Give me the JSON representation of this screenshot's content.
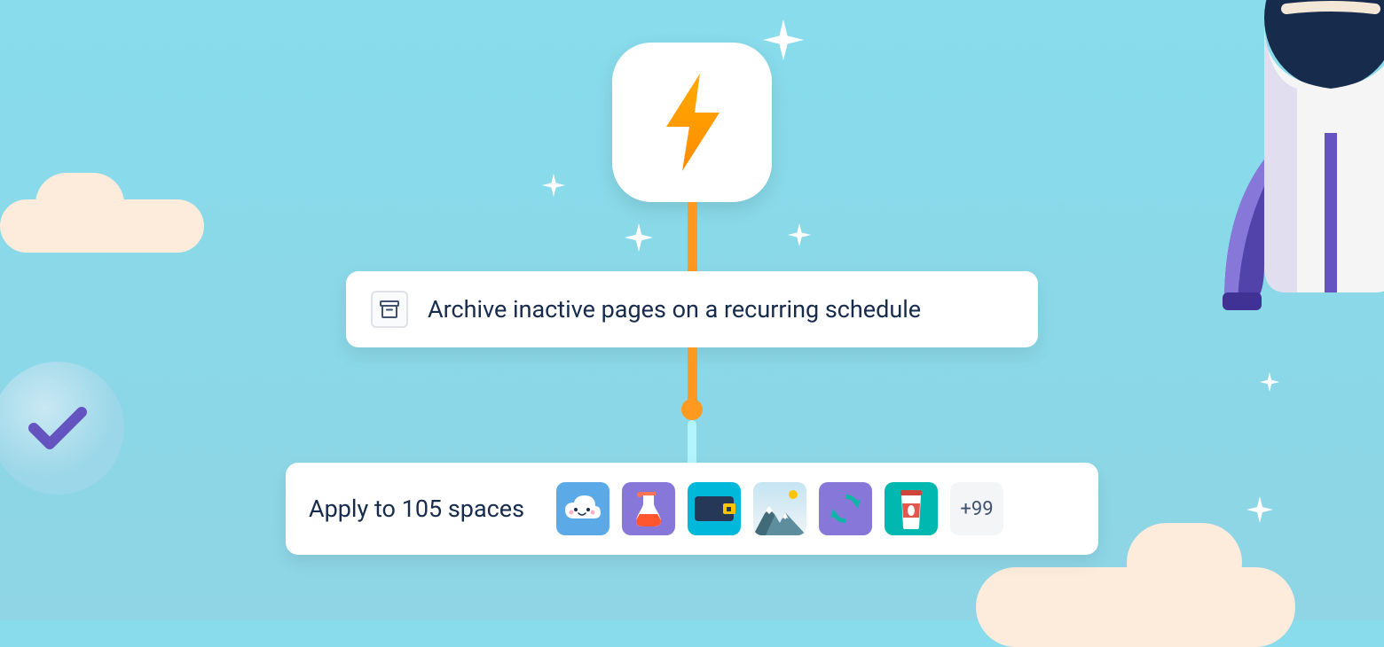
{
  "trigger": {
    "icon": "lightning-bolt-icon"
  },
  "rule": {
    "icon": "archive-box-icon",
    "title": "Archive inactive pages on a recurring schedule"
  },
  "spaces": {
    "label": "Apply to 105 spaces",
    "icons": [
      {
        "name": "cloud-space-icon",
        "bg": "#5ba9e6"
      },
      {
        "name": "flask-space-icon",
        "bg": "#8777d9"
      },
      {
        "name": "wallet-space-icon",
        "bg": "#00b8d9"
      },
      {
        "name": "mountain-space-icon",
        "bg": "#eef0f3"
      },
      {
        "name": "sync-space-icon",
        "bg": "#8777d9"
      },
      {
        "name": "coffee-space-icon",
        "bg": "#00b8b0"
      }
    ],
    "more_label": "+99"
  },
  "decorations": {
    "check_icon": "check-icon",
    "rocket_icon": "rocket-icon"
  }
}
